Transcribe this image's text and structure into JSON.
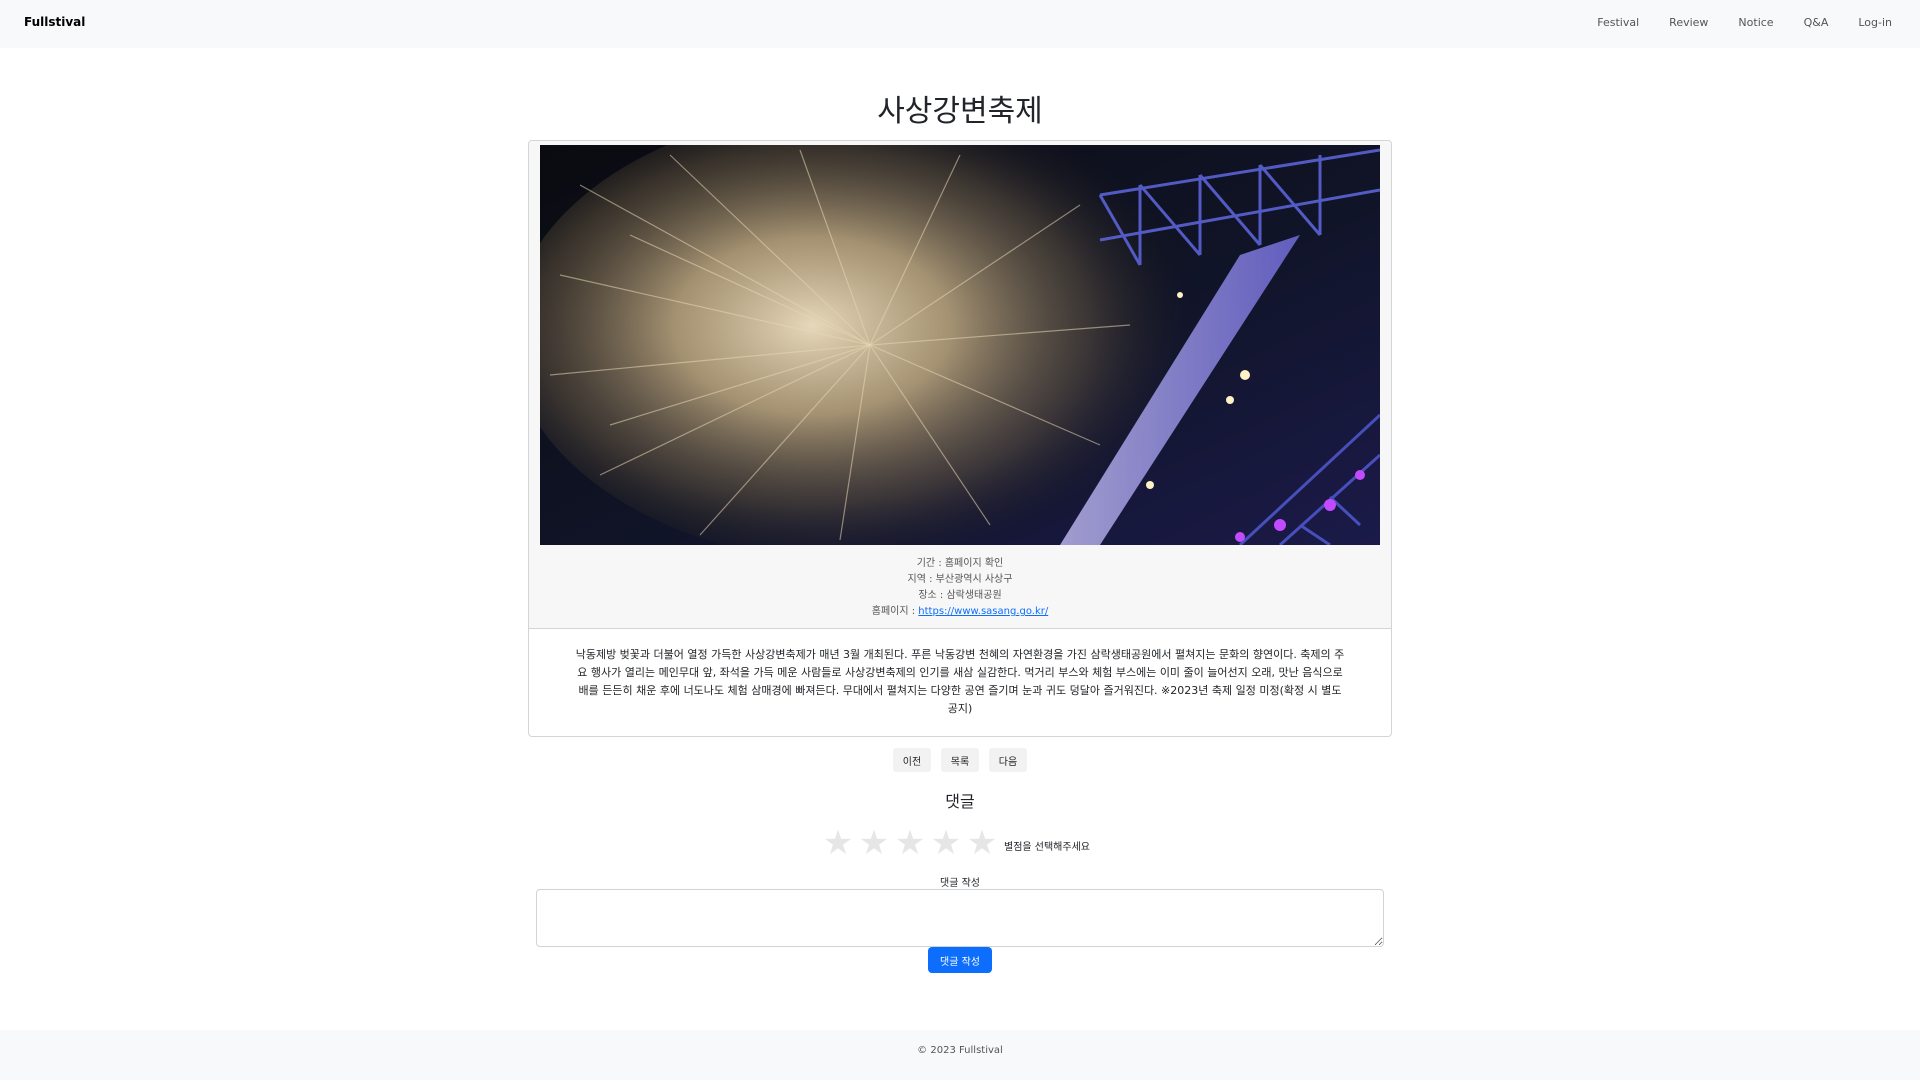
{
  "navbar": {
    "brand": "Fullstival",
    "items": [
      {
        "label": "Festival"
      },
      {
        "label": "Review"
      },
      {
        "label": "Notice"
      },
      {
        "label": "Q&A"
      },
      {
        "label": "Log-in"
      }
    ]
  },
  "festival": {
    "title": "사상강변축제",
    "info": {
      "period": "기간 : 홈페이지 확인",
      "region": "지역 : 부산광역시 사상구",
      "venue": "장소 : 삼락생태공원",
      "homepage_label": "홈페이지 : ",
      "homepage_url": "https://www.sasang.go.kr/"
    },
    "description": "낙동제방 벚꽃과 더불어 열정 가득한 사상강변축제가 매년 3월 개최된다. 푸른 낙동강변 천혜의 자연환경을 가진 삼락생태공원에서 펼쳐지는 문화의 향연이다. 축제의 주요 행사가 열리는 메인무대 앞, 좌석을 가득 메운 사람들로 사상강변축제의 인기를 새삼 실감한다. 먹거리 부스와 체험 부스에는 이미 줄이 늘어선지 오래, 맛난 음식으로 배를 든든히 채운 후에 너도나도 체험 삼매경에 빠져든다. 무대에서 펼쳐지는 다양한 공연 즐기며 눈과 귀도 덩달아 즐거워진다. ※2023년 축제 일정 미정(확정 시 별도 공지)"
  },
  "pager": {
    "prev": "이전",
    "list": "목록",
    "next": "다음"
  },
  "comments": {
    "title": "댓글",
    "rating_hint": "별점을 선택해주세요",
    "stars": [
      "★",
      "★",
      "★",
      "★",
      "★"
    ],
    "rating_value": 0,
    "write_label": "댓글 작성",
    "input_value": "",
    "submit_label": "댓글 작성"
  },
  "footer": {
    "text": "© 2023 Fullstival"
  },
  "colors": {
    "primary": "#0d6efd",
    "navbar_bg": "#f8f9fa",
    "star_empty": "#e6e6e6"
  },
  "icons": {
    "star": "star-icon"
  }
}
